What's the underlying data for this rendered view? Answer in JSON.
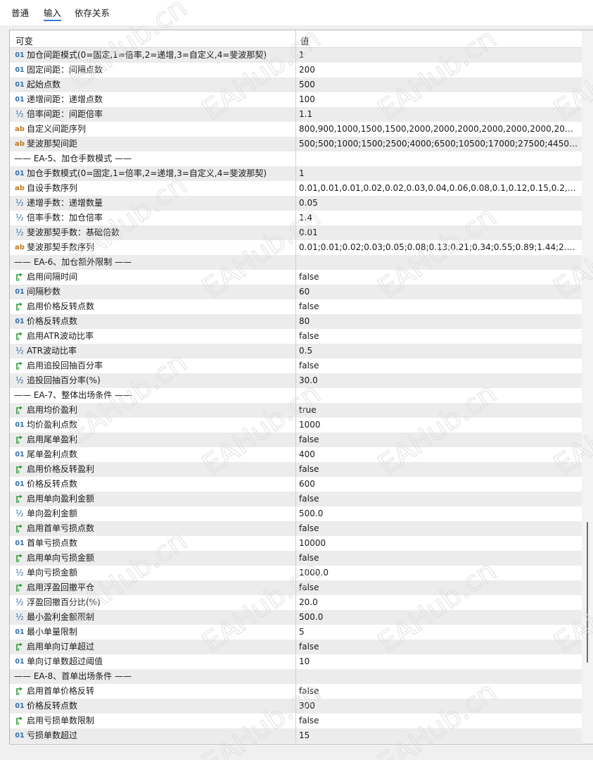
{
  "tabs": [
    {
      "label": "普通",
      "active": false
    },
    {
      "label": "输入",
      "active": true
    },
    {
      "label": "依存关系",
      "active": false
    }
  ],
  "table": {
    "col_variable": "可变",
    "col_value": "值",
    "rows": [
      {
        "type": "int",
        "name": "加仓间距模式(0=固定,1=倍率,2=递增,3=自定义,4=斐波那契)",
        "value": "1"
      },
      {
        "type": "int",
        "name": "固定间距：间隔点数",
        "value": "200"
      },
      {
        "type": "int",
        "name": "起始点数",
        "value": "500"
      },
      {
        "type": "int",
        "name": "递增间距：递增点数",
        "value": "100"
      },
      {
        "type": "double",
        "name": "倍率间距：间距倍率",
        "value": "1.1"
      },
      {
        "type": "string",
        "name": "自定义间距序列",
        "value": "800,900,1000,1500,1500,2000,2000,2000,2000,2000,2000,2000,2000,..."
      },
      {
        "type": "string",
        "name": "斐波那契间距",
        "value": "500;500;1000;1500;2500;4000;6500;10500;17000;27500;44500;7200..."
      },
      {
        "type": "separator",
        "name": "—— EA-5、加仓手数模式 ——",
        "value": ""
      },
      {
        "type": "int",
        "name": "加仓手数模式(0=固定,1=倍率,2=递增,3=自定义,4=斐波那契)",
        "value": "1"
      },
      {
        "type": "string",
        "name": "自设手数序列",
        "value": "0.01,0.01,0.01,0.02,0.02,0.03,0.04,0.06,0.08,0.1,0.12,0.15,0.2,0.2"
      },
      {
        "type": "double",
        "name": "递增手数：递增数量",
        "value": "0.05"
      },
      {
        "type": "double",
        "name": "倍率手数：加仓倍率",
        "value": "1.4"
      },
      {
        "type": "double",
        "name": "斐波那契手数：基础倍数",
        "value": "0.01"
      },
      {
        "type": "string",
        "name": "斐波那契手数序列",
        "value": "0.01;0.01;0.02;0.03;0.05;0.08;0.13;0.21;0.34;0.55;0.89;1.44;2.33;3.77;6...."
      },
      {
        "type": "separator",
        "name": "—— EA-6、加仓额外限制 ——",
        "value": ""
      },
      {
        "type": "bool",
        "name": "启用间隔时间",
        "value": "false"
      },
      {
        "type": "int",
        "name": "间隔秒数",
        "value": "60"
      },
      {
        "type": "bool",
        "name": "启用价格反转点数",
        "value": "false"
      },
      {
        "type": "int",
        "name": "价格反转点数",
        "value": "80"
      },
      {
        "type": "bool",
        "name": "启用ATR波动比率",
        "value": "false"
      },
      {
        "type": "double",
        "name": "ATR波动比率",
        "value": "0.5"
      },
      {
        "type": "bool",
        "name": "启用追投回抽百分率",
        "value": "false"
      },
      {
        "type": "double",
        "name": "追投回抽百分率(%)",
        "value": "30.0"
      },
      {
        "type": "separator",
        "name": "—— EA-7、整体出场条件 ——",
        "value": ""
      },
      {
        "type": "bool",
        "name": "启用均价盈利",
        "value": "true"
      },
      {
        "type": "int",
        "name": "均价盈利点数",
        "value": "1000"
      },
      {
        "type": "bool",
        "name": "启用尾单盈利",
        "value": "false"
      },
      {
        "type": "int",
        "name": "尾单盈利点数",
        "value": "400"
      },
      {
        "type": "bool",
        "name": "启用价格反转盈利",
        "value": "false"
      },
      {
        "type": "int",
        "name": "价格反转点数",
        "value": "600"
      },
      {
        "type": "bool",
        "name": "启用单向盈利金额",
        "value": "false"
      },
      {
        "type": "double",
        "name": "单向盈利金额",
        "value": "500.0"
      },
      {
        "type": "bool",
        "name": "启用首单亏损点数",
        "value": "false"
      },
      {
        "type": "int",
        "name": "首单亏损点数",
        "value": "10000"
      },
      {
        "type": "bool",
        "name": "启用单向亏损金额",
        "value": "false"
      },
      {
        "type": "double",
        "name": "单向亏损金额",
        "value": "1000.0"
      },
      {
        "type": "bool",
        "name": "启用浮盈回撤平仓",
        "value": "false"
      },
      {
        "type": "double",
        "name": "浮盈回撤百分比(%)",
        "value": "20.0"
      },
      {
        "type": "double",
        "name": "最小盈利金额限制",
        "value": "500.0"
      },
      {
        "type": "int",
        "name": "最小单量限制",
        "value": "5"
      },
      {
        "type": "bool",
        "name": "启用单向订单超过",
        "value": "false"
      },
      {
        "type": "int",
        "name": "单向订单数超过阈值",
        "value": "10"
      },
      {
        "type": "separator",
        "name": "—— EA-8、首单出场条件 ——",
        "value": ""
      },
      {
        "type": "bool",
        "name": "启用首单价格反转",
        "value": "false"
      },
      {
        "type": "int",
        "name": "价格反转点数",
        "value": "300"
      },
      {
        "type": "bool",
        "name": "启用亏损单数限制",
        "value": "false"
      },
      {
        "type": "int",
        "name": "亏损单数超过",
        "value": "15"
      }
    ]
  },
  "icons": {
    "int": "01",
    "double": "½",
    "string": "ab"
  },
  "watermark": "EAHub.cn",
  "colors": {
    "accent": "#3a7bd5",
    "bool_icon": "#2e9a3a",
    "int_icon": "#2f6fb0",
    "string_icon": "#c07a1e"
  }
}
